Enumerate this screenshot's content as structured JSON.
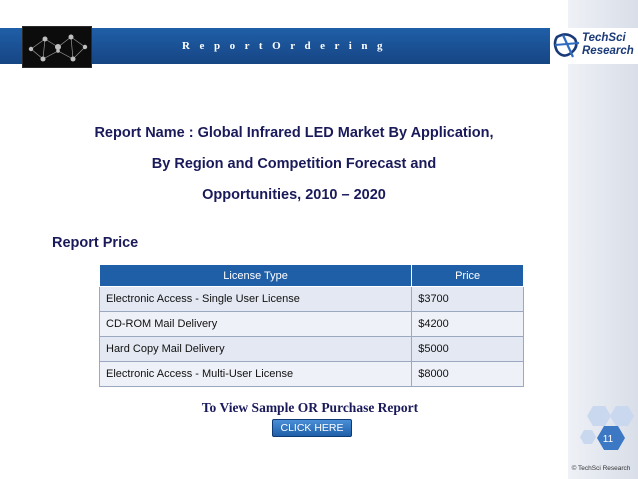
{
  "header": {
    "title": "R e p o r t   O r d e r i n g"
  },
  "logo": {
    "line1": "TechSci",
    "line2": "Research"
  },
  "report": {
    "line1": "Report Name : Global Infrared LED Market By Application,",
    "line2": "By Region and Competition Forecast and",
    "line3": "Opportunities, 2010 – 2020"
  },
  "price_section": {
    "heading": "Report Price",
    "columns": [
      "License Type",
      "Price"
    ],
    "rows": [
      {
        "type": "Electronic Access - Single User License",
        "price": "$3700"
      },
      {
        "type": "CD-ROM Mail Delivery",
        "price": "$4200"
      },
      {
        "type": "Hard Copy Mail Delivery",
        "price": "$5000"
      },
      {
        "type": "Electronic Access - Multi-User License",
        "price": "$8000"
      }
    ]
  },
  "cta": {
    "text": "To View Sample OR Purchase Report",
    "button_label": "CLICK HERE"
  },
  "footer": {
    "page_number": "11",
    "copyright": "© TechSci Research"
  },
  "colors": {
    "accent_blue": "#1f5fa8",
    "heading_navy": "#1a1a5a",
    "hex_blue": "#b9cde8"
  }
}
